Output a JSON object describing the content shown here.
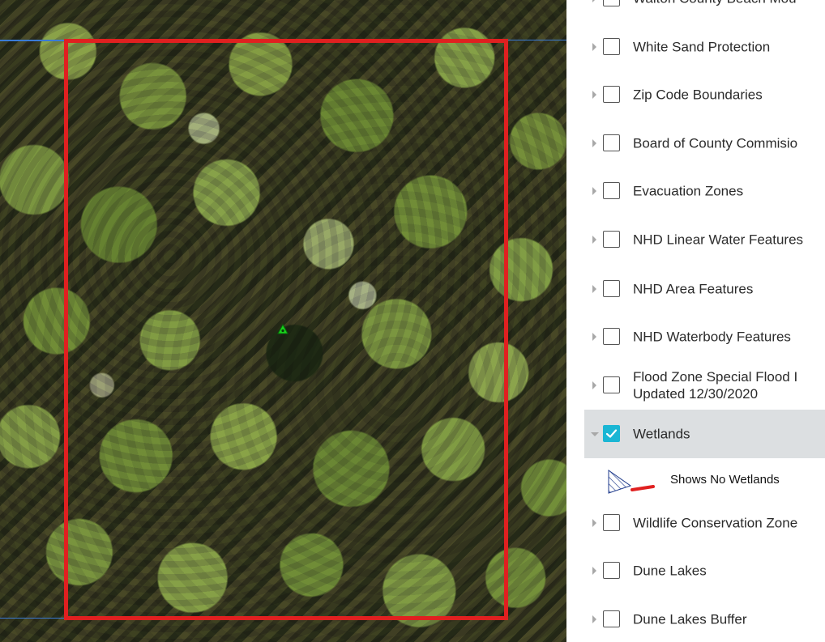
{
  "map": {
    "boundary_color": "#e02020",
    "marker_color": "#19d21c"
  },
  "layers": [
    {
      "label": "Walton County Beach Mou",
      "checked": false,
      "expanded": false
    },
    {
      "label": "White Sand Protection",
      "checked": false,
      "expanded": false
    },
    {
      "label": "Zip Code Boundaries",
      "checked": false,
      "expanded": false
    },
    {
      "label": "Board of County Commisio",
      "checked": false,
      "expanded": false
    },
    {
      "label": "Evacuation Zones",
      "checked": false,
      "expanded": false
    },
    {
      "label": "NHD Linear Water Features",
      "checked": false,
      "expanded": false
    },
    {
      "label": "NHD Area Features",
      "checked": false,
      "expanded": false
    },
    {
      "label": "NHD Waterbody Features",
      "checked": false,
      "expanded": false
    },
    {
      "label_line1": "Flood Zone Special Flood I",
      "label_line2": "Updated 12/30/2020",
      "checked": false,
      "expanded": false
    },
    {
      "label": "Wetlands",
      "checked": true,
      "expanded": true
    },
    {
      "label": "Wildlife Conservation Zone",
      "checked": false,
      "expanded": false
    },
    {
      "label": "Dune Lakes",
      "checked": false,
      "expanded": false
    },
    {
      "label": "Dune Lakes Buffer",
      "checked": false,
      "expanded": false
    }
  ],
  "legend": {
    "wetlands_label": "Shows No Wetlands",
    "swatch_color": "#e02020",
    "hatch_color": "#1f3b8c"
  },
  "colors": {
    "accent": "#1ab6d4",
    "selected_row_bg": "#dcdfe1"
  }
}
